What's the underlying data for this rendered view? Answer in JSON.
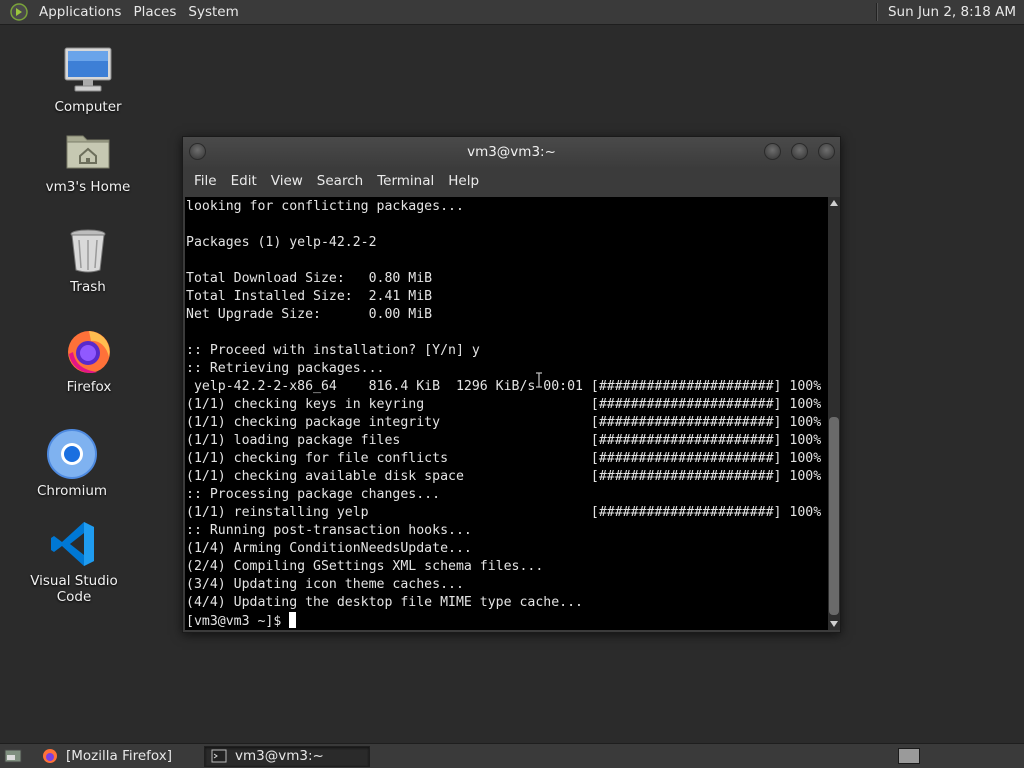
{
  "top_panel": {
    "menus": [
      "Applications",
      "Places",
      "System"
    ],
    "clock": "Sun Jun  2, 8:18 AM"
  },
  "desktop_icons": [
    {
      "label": "Computer",
      "icon": "computer-icon"
    },
    {
      "label": "vm3's Home",
      "icon": "home-folder-icon"
    },
    {
      "label": "Trash",
      "icon": "trash-icon"
    },
    {
      "label": "Firefox",
      "icon": "firefox-icon"
    },
    {
      "label": "Chromium",
      "icon": "chromium-icon"
    },
    {
      "label": "Visual Studio Code",
      "icon": "vscode-icon"
    }
  ],
  "terminal": {
    "title": "vm3@vm3:~",
    "menu": [
      "File",
      "Edit",
      "View",
      "Search",
      "Terminal",
      "Help"
    ],
    "lines": [
      "looking for conflicting packages...",
      "",
      "Packages (1) yelp-42.2-2",
      "",
      "Total Download Size:   0.80 MiB",
      "Total Installed Size:  2.41 MiB",
      "Net Upgrade Size:      0.00 MiB",
      "",
      ":: Proceed with installation? [Y/n] y",
      ":: Retrieving packages...",
      " yelp-42.2-2-x86_64    816.4 KiB  1296 KiB/s 00:01 [######################] 100%",
      "(1/1) checking keys in keyring                     [######################] 100%",
      "(1/1) checking package integrity                   [######################] 100%",
      "(1/1) loading package files                        [######################] 100%",
      "(1/1) checking for file conflicts                  [######################] 100%",
      "(1/1) checking available disk space                [######################] 100%",
      ":: Processing package changes...",
      "(1/1) reinstalling yelp                            [######################] 100%",
      ":: Running post-transaction hooks...",
      "(1/4) Arming ConditionNeedsUpdate...",
      "(2/4) Compiling GSettings XML schema files...",
      "(3/4) Updating icon theme caches...",
      "(4/4) Updating the desktop file MIME type cache..."
    ],
    "prompt": "[vm3@vm3 ~]$ "
  },
  "taskbar": {
    "tasks": [
      {
        "label": "[Mozilla Firefox]",
        "icon": "firefox-icon",
        "active": false
      },
      {
        "label": "vm3@vm3:~",
        "icon": "terminal-icon",
        "active": true
      }
    ]
  },
  "colors": {
    "desktop_bg": "#2b2b2b",
    "panel_bg": "#3a3a3a",
    "terminal_bg": "#000000",
    "terminal_fg": "#e4e4e4"
  }
}
